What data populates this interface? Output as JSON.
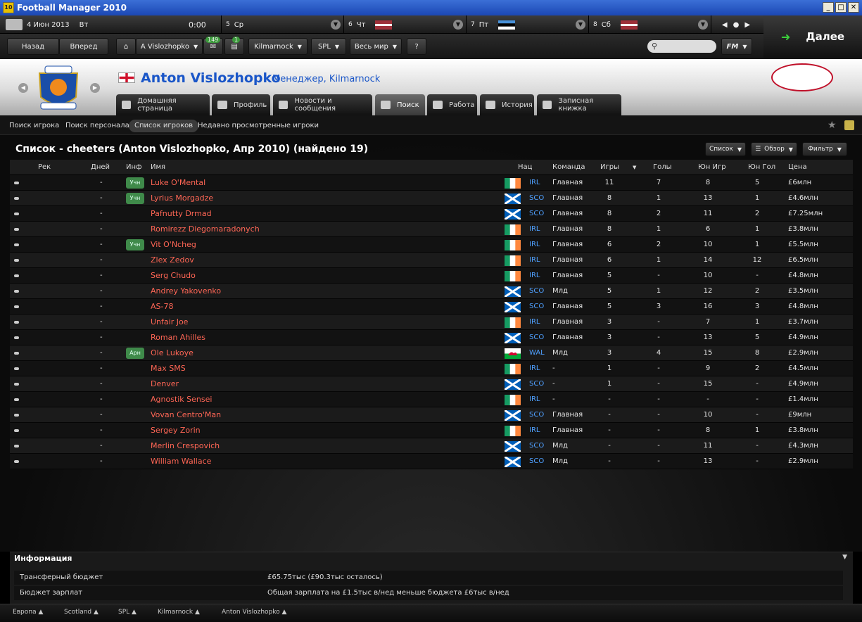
{
  "window": {
    "title": "Football Manager 2010",
    "logo_text": "10"
  },
  "calendar": {
    "date": "4 Июн 2013",
    "weekday": "Вт",
    "time": "0:00",
    "days": [
      {
        "num": "5",
        "day": "Ср"
      },
      {
        "num": "6",
        "day": "Чт"
      },
      {
        "num": "7",
        "day": "Пт"
      },
      {
        "num": "8",
        "day": "Сб"
      }
    ]
  },
  "nav": {
    "back": "Назад",
    "forward": "Вперед",
    "manager_menu": "A Vislozhopko",
    "inbox_count": "149",
    "news_count": "1",
    "club_menu": "Kilmarnock",
    "league_menu": "SPL",
    "world_menu": "Весь мир",
    "help": "?",
    "next": "Далее",
    "fm_menu": "FM"
  },
  "header": {
    "manager_name": "Anton Vislozhopko",
    "manager_role": "Менеджер, Kilmarnock",
    "tabs": [
      {
        "label": "Домашняя страница"
      },
      {
        "label": "Профиль"
      },
      {
        "label": "Новости и сообщения"
      },
      {
        "label": "Поиск"
      },
      {
        "label": "Работа"
      },
      {
        "label": "История"
      },
      {
        "label": "Записная книжка"
      }
    ]
  },
  "subnav": [
    "Поиск игрока",
    "Поиск персонала",
    "Список игроков",
    "Недавно просмотренные игроки"
  ],
  "list": {
    "title": "Список - cheeters (Anton Vislozhopko, Апр 2010) (найдено 19)",
    "buttons": {
      "list": "Список",
      "view": "Обзор",
      "filter": "Фильтр"
    },
    "columns": {
      "rec": "Рек",
      "days": "Дней",
      "inf": "Инф",
      "name": "Имя",
      "nat": "Нац",
      "team": "Команда",
      "apps": "Игры",
      "goals": "Голы",
      "yapps": "Юн Игр",
      "ygoals": "Юн Гол",
      "price": "Цена"
    },
    "rows": [
      {
        "days": "-",
        "inf": "Учн",
        "name": "Luke O'Mental",
        "flag": "IRL",
        "nat": "IRL",
        "team": "Главная",
        "apps": "11",
        "goals": "7",
        "yapps": "8",
        "ygoals": "5",
        "price": "£6млн"
      },
      {
        "days": "-",
        "inf": "Учн",
        "name": "Lyrius Morgadze",
        "flag": "SCO",
        "nat": "SCO",
        "team": "Главная",
        "apps": "8",
        "goals": "1",
        "yapps": "13",
        "ygoals": "1",
        "price": "£4.6млн"
      },
      {
        "days": "-",
        "inf": "",
        "name": "Pafnutty Drmad",
        "flag": "SCO",
        "nat": "SCO",
        "team": "Главная",
        "apps": "8",
        "goals": "2",
        "yapps": "11",
        "ygoals": "2",
        "price": "£7.25млн"
      },
      {
        "days": "-",
        "inf": "",
        "name": "Romirezz Diegomaradonych",
        "flag": "IRL",
        "nat": "IRL",
        "team": "Главная",
        "apps": "8",
        "goals": "1",
        "yapps": "6",
        "ygoals": "1",
        "price": "£3.8млн"
      },
      {
        "days": "-",
        "inf": "Учн",
        "name": "Vit O'Ncheg",
        "flag": "IRL",
        "nat": "IRL",
        "team": "Главная",
        "apps": "6",
        "goals": "2",
        "yapps": "10",
        "ygoals": "1",
        "price": "£5.5млн"
      },
      {
        "days": "-",
        "inf": "",
        "name": "Zlex Zedov",
        "flag": "IRL",
        "nat": "IRL",
        "team": "Главная",
        "apps": "6",
        "goals": "1",
        "yapps": "14",
        "ygoals": "12",
        "price": "£6.5млн"
      },
      {
        "days": "-",
        "inf": "",
        "name": "Serg Chudo",
        "flag": "IRL",
        "nat": "IRL",
        "team": "Главная",
        "apps": "5",
        "goals": "-",
        "yapps": "10",
        "ygoals": "-",
        "price": "£4.8млн"
      },
      {
        "days": "-",
        "inf": "",
        "name": "Andrey Yakovenko",
        "flag": "SCO",
        "nat": "SCO",
        "team": "Млд",
        "apps": "5",
        "goals": "1",
        "yapps": "12",
        "ygoals": "2",
        "price": "£3.5млн"
      },
      {
        "days": "-",
        "inf": "",
        "name": "AS-78",
        "flag": "SCO",
        "nat": "SCO",
        "team": "Главная",
        "apps": "5",
        "goals": "3",
        "yapps": "16",
        "ygoals": "3",
        "price": "£4.8млн"
      },
      {
        "days": "-",
        "inf": "",
        "name": "Unfair Joe",
        "flag": "IRL",
        "nat": "IRL",
        "team": "Главная",
        "apps": "3",
        "goals": "-",
        "yapps": "7",
        "ygoals": "1",
        "price": "£3.7млн"
      },
      {
        "days": "-",
        "inf": "",
        "name": "Roman Ahilles",
        "flag": "SCO",
        "nat": "SCO",
        "team": "Главная",
        "apps": "3",
        "goals": "-",
        "yapps": "13",
        "ygoals": "5",
        "price": "£4.9млн"
      },
      {
        "days": "-",
        "inf": "Арн",
        "name": "Ole Lukoye",
        "flag": "WAL",
        "nat": "WAL",
        "team": "Млд",
        "apps": "3",
        "goals": "4",
        "yapps": "15",
        "ygoals": "8",
        "price": "£2.9млн"
      },
      {
        "days": "-",
        "inf": "",
        "name": "Max SMS",
        "flag": "IRL",
        "nat": "IRL",
        "team": "-",
        "apps": "1",
        "goals": "-",
        "yapps": "9",
        "ygoals": "2",
        "price": "£4.5млн"
      },
      {
        "days": "-",
        "inf": "",
        "name": "Denver",
        "flag": "SCO",
        "nat": "SCO",
        "team": "-",
        "apps": "1",
        "goals": "-",
        "yapps": "15",
        "ygoals": "-",
        "price": "£4.9млн"
      },
      {
        "days": "-",
        "inf": "",
        "name": "Agnostik Sensei",
        "flag": "IRL",
        "nat": "IRL",
        "team": "-",
        "apps": "-",
        "goals": "-",
        "yapps": "-",
        "ygoals": "-",
        "price": "£1.4млн"
      },
      {
        "days": "-",
        "inf": "",
        "name": "Vovan Centro'Man",
        "flag": "SCO",
        "nat": "SCO",
        "team": "Главная",
        "apps": "-",
        "goals": "-",
        "yapps": "10",
        "ygoals": "-",
        "price": "£9млн"
      },
      {
        "days": "-",
        "inf": "",
        "name": "Sergey Zorin",
        "flag": "IRL",
        "nat": "IRL",
        "team": "Главная",
        "apps": "-",
        "goals": "-",
        "yapps": "8",
        "ygoals": "1",
        "price": "£3.8млн"
      },
      {
        "days": "-",
        "inf": "",
        "name": "Merlin Crespovich",
        "flag": "SCO",
        "nat": "SCO",
        "team": "Млд",
        "apps": "-",
        "goals": "-",
        "yapps": "11",
        "ygoals": "-",
        "price": "£4.3млн"
      },
      {
        "days": "-",
        "inf": "",
        "name": "William Wallace",
        "flag": "SCO",
        "nat": "SCO",
        "team": "Млд",
        "apps": "-",
        "goals": "-",
        "yapps": "13",
        "ygoals": "-",
        "price": "£2.9млн"
      }
    ]
  },
  "info": {
    "title": "Информация",
    "transfer_label": "Трансферный бюджет",
    "transfer_value": "£65.75тыс (£90.3тыс осталось)",
    "wage_label": "Бюджет зарплат",
    "wage_value": "Общая зарплата на £1.5тыс в/нед меньше бюджета £6тыс в/нед"
  },
  "footer": [
    "Европа",
    "Scotland",
    "SPL",
    "Kilmarnock",
    "Anton Vislozhopko"
  ],
  "colors": {
    "name_red": "#ff6655",
    "nat_blue": "#4fa0ff",
    "badge_green": "#3f8a4a",
    "manager_blue": "#1a56c8"
  }
}
